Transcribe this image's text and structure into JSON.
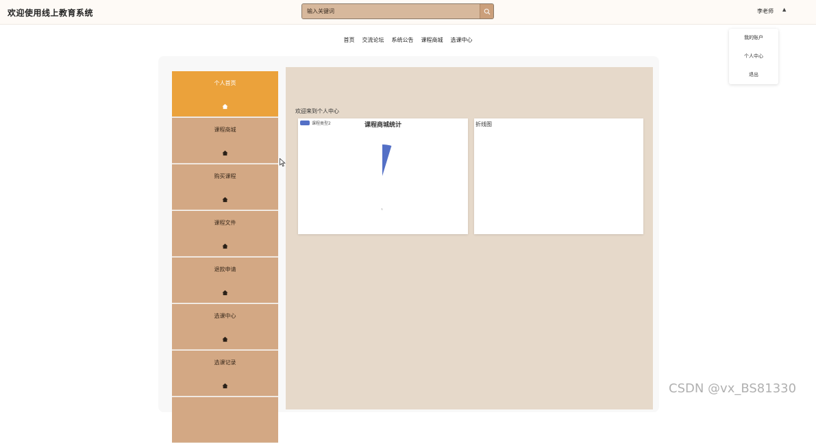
{
  "header": {
    "title": "欢迎使用线上教育系统",
    "search_placeholder": "输入关键词",
    "user_name": "李老师",
    "user_caret": "▲"
  },
  "dropdown": {
    "items": [
      "我的账户",
      "个人中心",
      "退出"
    ]
  },
  "nav": {
    "items": [
      "首页",
      "交流论坛",
      "系统公告",
      "课程商城",
      "选课中心"
    ]
  },
  "sidebar": {
    "items": [
      {
        "label": "个人首页",
        "active": true
      },
      {
        "label": "课程商城",
        "active": false
      },
      {
        "label": "购买课程",
        "active": false
      },
      {
        "label": "课程文件",
        "active": false
      },
      {
        "label": "退款申请",
        "active": false
      },
      {
        "label": "选课中心",
        "active": false
      },
      {
        "label": "选课记录",
        "active": false
      },
      {
        "label": "",
        "active": false
      }
    ],
    "icon": "home-icon"
  },
  "main": {
    "welcome": "欢迎来到个人中心",
    "pie_card": {
      "title": "课程商城统计",
      "legend": "课程类型2",
      "slice_color": "#5470c6"
    },
    "line_card": {
      "title": "折线图"
    }
  },
  "colors": {
    "active": "#eba23b",
    "sidebar": "#d3a884",
    "panel": "#e6d9ca",
    "search": "#d7b89c"
  },
  "watermark": "CSDN @vx_BS81330"
}
